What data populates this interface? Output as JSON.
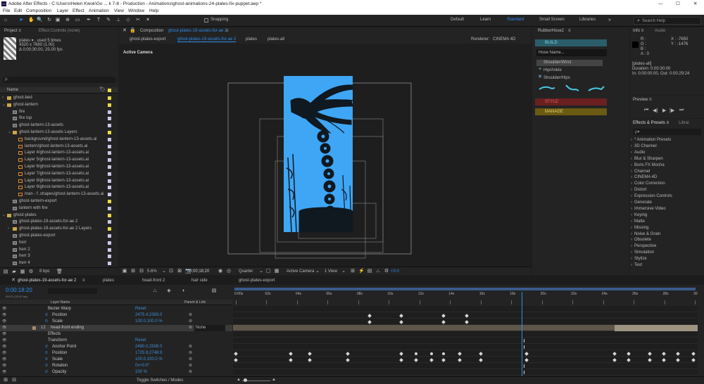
{
  "title_bar": {
    "title": "Adobe After Effects - C:\\Users\\Helen Kwok\\Go ... k 7-8 - Production - Animations\\ghost-animations-24-plates-fix-puppet.aep *",
    "minimize": "—",
    "maximize": "☐",
    "close": "✕"
  },
  "menu": [
    "File",
    "Edit",
    "Composition",
    "Layer",
    "Effect",
    "Animation",
    "View",
    "Window",
    "Help"
  ],
  "toolbar": {
    "snapping": "Snapping",
    "workspaces": [
      "Default",
      "Learn",
      "Standard",
      "Small Screen",
      "Libraries"
    ],
    "search_placeholder": "Search Help"
  },
  "project": {
    "tab": "Project",
    "tab2": "Effect Controls (none)",
    "item_name": "plates ▾ , used 5 times",
    "item_size": "4320 x 7680 (1.00)",
    "item_duration": "Δ 0;00;30;00, 25.00 fps",
    "search_placeholder": "ρ.",
    "col_name": "Name",
    "items": [
      {
        "label": "ghost-bed",
        "indent": 0,
        "type": "folder",
        "twirl": "›",
        "color": "#e8d84a"
      },
      {
        "label": "ghost-lantern",
        "indent": 0,
        "type": "folder",
        "twirl": "⌄",
        "color": "#e8d84a"
      },
      {
        "label": "fire",
        "indent": 1,
        "type": "comp",
        "twirl": "",
        "color": "#c8c8e8"
      },
      {
        "label": "fire top",
        "indent": 1,
        "type": "comp",
        "twirl": "",
        "color": "#c8c8e8"
      },
      {
        "label": "ghost-lantern-13-assets",
        "indent": 1,
        "type": "comp",
        "twirl": "",
        "color": "#c8c8e8"
      },
      {
        "label": "ghost-lantern-13-assets Layers",
        "indent": 1,
        "type": "folder",
        "twirl": "⌄",
        "color": "#e8d84a"
      },
      {
        "label": "background/ghost-lantern-13-assets.ai",
        "indent": 2,
        "type": "ai",
        "twirl": "",
        "color": "#c8c8e8"
      },
      {
        "label": "lantern/ghost-lantern-13-assets.ai",
        "indent": 2,
        "type": "ai",
        "twirl": "",
        "color": "#c8c8e8"
      },
      {
        "label": "Layer 4/ghost-lantern-13-assets.ai",
        "indent": 2,
        "type": "ai",
        "twirl": "",
        "color": "#c8c8e8"
      },
      {
        "label": "Layer 5/ghost-lantern-13-assets.ai",
        "indent": 2,
        "type": "ai",
        "twirl": "",
        "color": "#c8c8e8"
      },
      {
        "label": "Layer 6/ghost-lantern-13-assets.ai",
        "indent": 2,
        "type": "ai",
        "twirl": "",
        "color": "#c8c8e8"
      },
      {
        "label": "Layer 7/ghost-lantern-13-assets.ai",
        "indent": 2,
        "type": "ai",
        "twirl": "",
        "color": "#c8c8e8"
      },
      {
        "label": "Layer 8/ghost-lantern-13-assets.ai",
        "indent": 2,
        "type": "ai",
        "twirl": "",
        "color": "#c8c8e8"
      },
      {
        "label": "Layer 9/ghost-lantern-13-assets.ai",
        "indent": 2,
        "type": "ai",
        "twirl": "",
        "color": "#c8c8e8"
      },
      {
        "label": "man - f..shapes/ghost-lantern-13-assets.ai",
        "indent": 2,
        "type": "ai",
        "twirl": "",
        "color": "#c8c8e8"
      },
      {
        "label": "ghost-lantern-export",
        "indent": 1,
        "type": "comp",
        "twirl": "",
        "color": "#e8d84a"
      },
      {
        "label": "lantern with fire",
        "indent": 1,
        "type": "comp",
        "twirl": "",
        "color": "#c8c8e8"
      },
      {
        "label": "ghost-plates",
        "indent": 0,
        "type": "folder",
        "twirl": "⌄",
        "color": "#e8d84a"
      },
      {
        "label": "ghost-plates-19-assets-for-ae 2",
        "indent": 1,
        "type": "comp",
        "twirl": "",
        "color": "#c8c8e8"
      },
      {
        "label": "ghost-plates-19-assets-for-ae 2 Layers",
        "indent": 1,
        "type": "folder",
        "twirl": "›",
        "color": "#e8d84a"
      },
      {
        "label": "ghost-plates-export",
        "indent": 1,
        "type": "comp",
        "twirl": "",
        "color": "#c8c8e8"
      },
      {
        "label": "herr",
        "indent": 1,
        "type": "comp",
        "twirl": "",
        "color": "#c8c8e8"
      },
      {
        "label": "herr 2",
        "indent": 1,
        "type": "comp",
        "twirl": "",
        "color": "#c8c8e8"
      },
      {
        "label": "herr 3",
        "indent": 1,
        "type": "comp",
        "twirl": "",
        "color": "#c8c8e8"
      },
      {
        "label": "herr 4",
        "indent": 1,
        "type": "comp",
        "twirl": "",
        "color": "#c8c8e8"
      }
    ],
    "bpc": "8 bpc"
  },
  "composition": {
    "panel_label": "Composition",
    "comp_name": "ghost-plates-19-assets-for-ae 2",
    "tabs": [
      "ghost-plates-export",
      "ghost-plates-19-assets-for-ae 2",
      "plates",
      "plates-all"
    ],
    "renderer_label": "Renderer:",
    "renderer": "CINEMA 4D",
    "active_camera": "Active Camera",
    "zoom": "5.6%",
    "timecode": "0;00;18;20",
    "resolution": "Quarter",
    "camera_select": "Active Camera",
    "view_select": "1 View",
    "exposure": "+0.0"
  },
  "rubberhose": {
    "title": "RubberHose2",
    "build": "BUILD",
    "hose_name_placeholder": "Hose Name...",
    "list": [
      "Shoulder/Wrist",
      "Hip/Ankle",
      "Shoulder/Hips"
    ],
    "style": "STYLE",
    "manage": "MANAGE"
  },
  "info": {
    "tab": "Info",
    "tab2": "Audio",
    "r": "R :",
    "g": "G :",
    "b": "B :",
    "a": "A : 0",
    "x": "X : -7650",
    "y": "Y : -1476",
    "layer": "[plates-all]",
    "duration": "Duration: 0:00:30:00",
    "inout": "In: 0:00:00:00, Out: 0:00:29:24"
  },
  "preview": {
    "tab": "Preview",
    "buttons": [
      "⏮",
      "◀|",
      "▶",
      "|▶",
      "⏭"
    ]
  },
  "effects": {
    "tab": "Effects & Presets",
    "tab2": "Librai",
    "search_placeholder": "ρ▾",
    "items": [
      "* Animation Presets",
      "3D Channel",
      "Audio",
      "Blur & Sharpen",
      "Boris FX Mocha",
      "Channel",
      "CINEMA 4D",
      "Color Correction",
      "Distort",
      "Expression Controls",
      "Generate",
      "Immersive Video",
      "Keying",
      "Matte",
      "Missing",
      "Noise & Grain",
      "Obsolete",
      "Perspective",
      "Simulation",
      "Stylize",
      "Text"
    ]
  },
  "timeline": {
    "tabs": [
      "ghost-plates-19-assets-for-ae 2",
      "plates",
      "head-front 2",
      "hair side",
      "ghost-plates-export"
    ],
    "timecode": "0:00:18:20",
    "frame_info": "00470 (25.00 fps)",
    "col_layer_name": "Layer Name",
    "col_parent": "Parent & Link",
    "rulers": [
      "0:00s",
      "02s",
      "04s",
      "06s",
      "08s",
      "10s",
      "12s",
      "14s",
      "16s",
      "18s",
      "20s",
      "22s",
      "24s",
      "26s",
      "28s",
      "30"
    ],
    "playhead_fraction": 0.6227,
    "toggle": "Toggle Switches / Modes",
    "rows": [
      {
        "name": "Bezier Warp",
        "value": "Reset",
        "indent": 1,
        "kind": "fx"
      },
      {
        "name": "Position",
        "value": "2475.4,2393.0",
        "indent": 2,
        "kind": "prop"
      },
      {
        "name": "Scale",
        "value": "100.0,100.0 %",
        "indent": 2,
        "kind": "prop"
      },
      {
        "name": "head-front ending",
        "value": "",
        "indent": 0,
        "kind": "layer",
        "num": "12",
        "parent": "None"
      },
      {
        "name": "Effects",
        "value": "",
        "indent": 1,
        "kind": "group"
      },
      {
        "name": "Transform",
        "value": "Reset",
        "indent": 1,
        "kind": "group"
      },
      {
        "name": "Anchor Point",
        "value": "2490.0,2508.0",
        "indent": 2,
        "kind": "prop"
      },
      {
        "name": "Position",
        "value": "1725.9,2748.9",
        "indent": 2,
        "kind": "prop"
      },
      {
        "name": "Scale",
        "value": "100.0,100.0 %",
        "indent": 2,
        "kind": "prop"
      },
      {
        "name": "Rotation",
        "value": "0x+0.0°",
        "indent": 2,
        "kind": "prop"
      },
      {
        "name": "Opacity",
        "value": "100 %",
        "indent": 2,
        "kind": "prop"
      }
    ]
  },
  "colors": {
    "accent": "#2d8ceb",
    "canvas": "#3ea6f5",
    "rh_build": "#2a5e6a",
    "rh_style": "#6a2020",
    "rh_manage": "#6b5a12"
  }
}
